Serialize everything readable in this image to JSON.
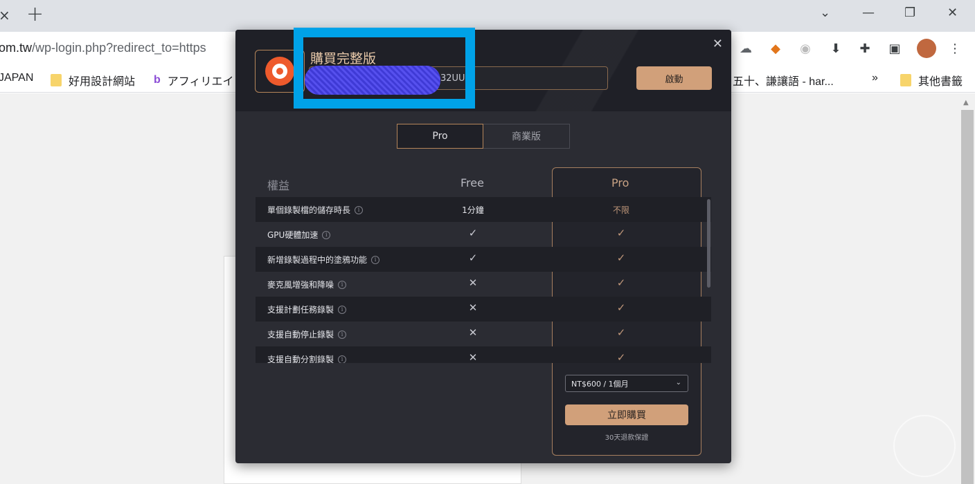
{
  "browser": {
    "tab_close_glyph": "×",
    "new_tab_glyph": "+",
    "url_host": "om.tw",
    "url_path": "/wp-login.php?redirect_to=https",
    "window_controls": [
      "chevron-down-icon",
      "minimize-icon",
      "restore-icon",
      "close-icon"
    ],
    "extensions": [
      "cloud-ext-icon",
      "metamask-fox-icon",
      "grammar-ext-icon",
      "download-ext-icon",
      "puzzle-icon",
      "side-panel-icon",
      "avatar",
      "kebab-menu-icon"
    ],
    "bookmarks": [
      {
        "label": "JAPAN",
        "icon": "none"
      },
      {
        "label": "好用設計網站",
        "icon": "folder-icon"
      },
      {
        "label": "アフィリエイ",
        "icon": "b-logo-icon"
      },
      {
        "label": "五十、謙讓語 - har...",
        "icon": "none"
      },
      {
        "label": "»",
        "icon": "none"
      },
      {
        "label": "其他書籤",
        "icon": "folder-icon"
      }
    ]
  },
  "dialog": {
    "close_glyph": "✕",
    "title": "購買完整版",
    "license_visible_suffix": "32UU",
    "activate_label": "啟動",
    "tabs": [
      {
        "label": "Pro",
        "active": true
      },
      {
        "label": "商業版",
        "active": false
      }
    ],
    "headers": {
      "benefit": "權益",
      "free": "Free",
      "pro": "Pro"
    },
    "features": [
      {
        "label": "單個錄製檔的儲存時長",
        "free": "1分鐘",
        "pro": "不限",
        "free_type": "text",
        "pro_type": "text"
      },
      {
        "label": "GPU硬體加速",
        "free": "✓",
        "pro": "✓",
        "free_type": "check",
        "pro_type": "check"
      },
      {
        "label": "新增錄製過程中的塗鴉功能",
        "free": "✓",
        "pro": "✓",
        "free_type": "check",
        "pro_type": "check"
      },
      {
        "label": "麥克風增強和降噪",
        "free": "✕",
        "pro": "✓",
        "free_type": "cross",
        "pro_type": "check"
      },
      {
        "label": "支援計劃任務錄製",
        "free": "✕",
        "pro": "✓",
        "free_type": "cross",
        "pro_type": "check"
      },
      {
        "label": "支援自動停止錄製",
        "free": "✕",
        "pro": "✓",
        "free_type": "cross",
        "pro_type": "check"
      },
      {
        "label": "支援自動分割錄製",
        "free": "✕",
        "pro": "✓",
        "free_type": "cross",
        "pro_type": "check"
      }
    ],
    "info_glyph": "i",
    "plan_select_value": "NT$600 / 1個月",
    "plan_chevron": "⌄",
    "buy_label": "立即購買",
    "guarantee": "30天退款保證",
    "accent_color": "#d1a07a"
  },
  "annotation": {
    "highlight_color": "#00a2e8"
  }
}
